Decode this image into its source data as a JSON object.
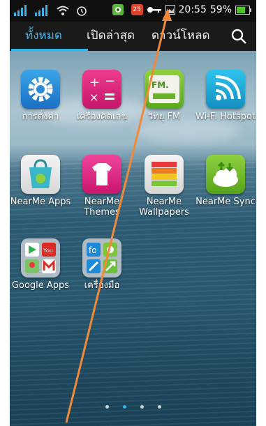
{
  "status_bar": {
    "time": "20:55",
    "battery_percent": "59%",
    "notification_count": "25",
    "icons": [
      "signal-icon",
      "signal-icon",
      "wifi-icon",
      "alarm-icon",
      "green-app-icon",
      "notification-badge-icon",
      "key-icon",
      "image-icon",
      "battery-icon"
    ]
  },
  "tabs": [
    {
      "label": "ทั้งหมด",
      "active": true
    },
    {
      "label": "เปิดล่าสุด",
      "active": false
    },
    {
      "label": "ดาวน์โหลด",
      "active": false
    }
  ],
  "apps": [
    {
      "label": "การตั้งค่า",
      "icon": "settings-gear-icon"
    },
    {
      "label": "เครื่องคิดเลข",
      "icon": "calculator-icon"
    },
    {
      "label": "วิทยุ FM",
      "icon": "fm-radio-icon",
      "icon_text": "FM."
    },
    {
      "label": "Wi-Fi Hotspot",
      "icon": "wifi-hotspot-icon"
    },
    {
      "label": "NearMe Apps",
      "icon": "nearme-apps-icon"
    },
    {
      "label": "NearMe Themes",
      "icon": "nearme-themes-icon"
    },
    {
      "label": "NearMe Wallpapers",
      "icon": "nearme-wallpapers-icon"
    },
    {
      "label": "NearMe Sync",
      "icon": "nearme-sync-icon"
    },
    {
      "label": "Google Apps",
      "icon": "google-apps-folder-icon"
    },
    {
      "label": "เครื่องมือ",
      "icon": "tools-folder-icon"
    }
  ],
  "page_indicator": {
    "count": 4,
    "active_index": 1
  },
  "colors": {
    "accent": "#39b3e6",
    "arrow": "#f08a3a"
  }
}
